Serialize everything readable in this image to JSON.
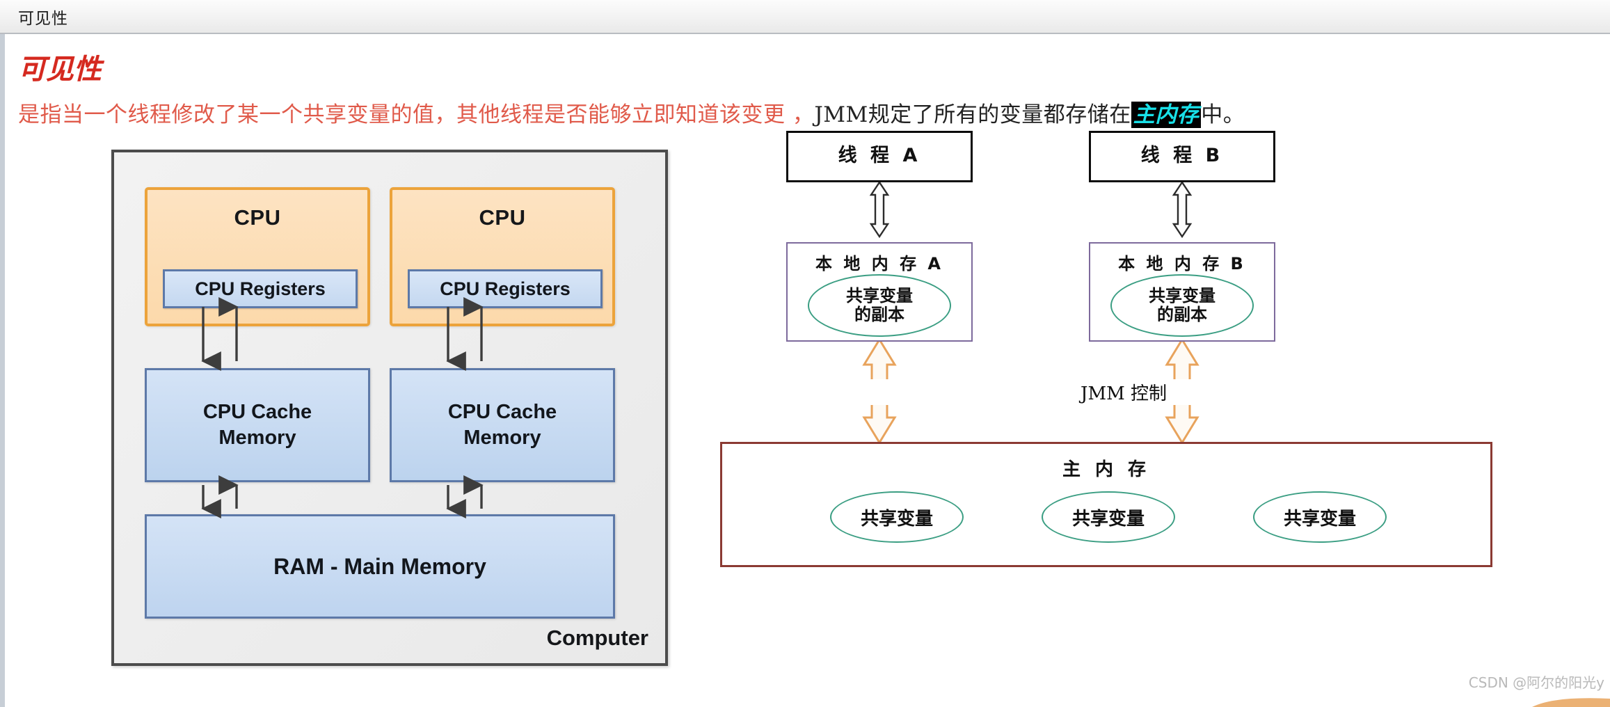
{
  "window": {
    "title": "可见性"
  },
  "article": {
    "heading": "可见性",
    "body_part1": "是指当一个线程修改了某一个共享变量的值，其他线程是否能够立即知道该变更 ，",
    "body_part2": "JMM规定了所有的变量都存储在",
    "body_highlight": "主内存",
    "body_part3": "中。"
  },
  "computer_diagram": {
    "outer_label": "Computer",
    "cpu_a": {
      "title": "CPU",
      "registers": "CPU Registers"
    },
    "cpu_b": {
      "title": "CPU",
      "registers": "CPU Registers"
    },
    "cache_a": {
      "line1": "CPU Cache",
      "line2": "Memory"
    },
    "cache_b": {
      "line1": "CPU Cache",
      "line2": "Memory"
    },
    "ram": "RAM - Main Memory"
  },
  "jmm_diagram": {
    "thread_a": "线 程 A",
    "thread_b": "线 程 B",
    "local_a": {
      "title": "本 地 内 存 A",
      "var_line1": "共享变量",
      "var_line2": "的副本"
    },
    "local_b": {
      "title": "本 地 内 存 B",
      "var_line1": "共享变量",
      "var_line2": "的副本"
    },
    "control_label": "JMM 控制",
    "main_memory": {
      "title": "主 内 存",
      "variables": [
        "共享变量",
        "共享变量",
        "共享变量"
      ]
    }
  },
  "watermark": "CSDN @阿尔的阳光y",
  "colors": {
    "heading_red": "#d5291f",
    "body_red": "#e05a4a",
    "highlight_bg": "#000000",
    "highlight_fg": "#18e0e8",
    "cpu_fill": "#fcd9ab",
    "cpu_border": "#eca33b",
    "blue_fill": "#c4d8f0",
    "blue_border": "#5d79a8",
    "local_border": "#7d6a9c",
    "main_mem_border": "#8b3a33",
    "ellipse_border": "#3b9e83",
    "orange_arrow": "#e8a35c"
  }
}
